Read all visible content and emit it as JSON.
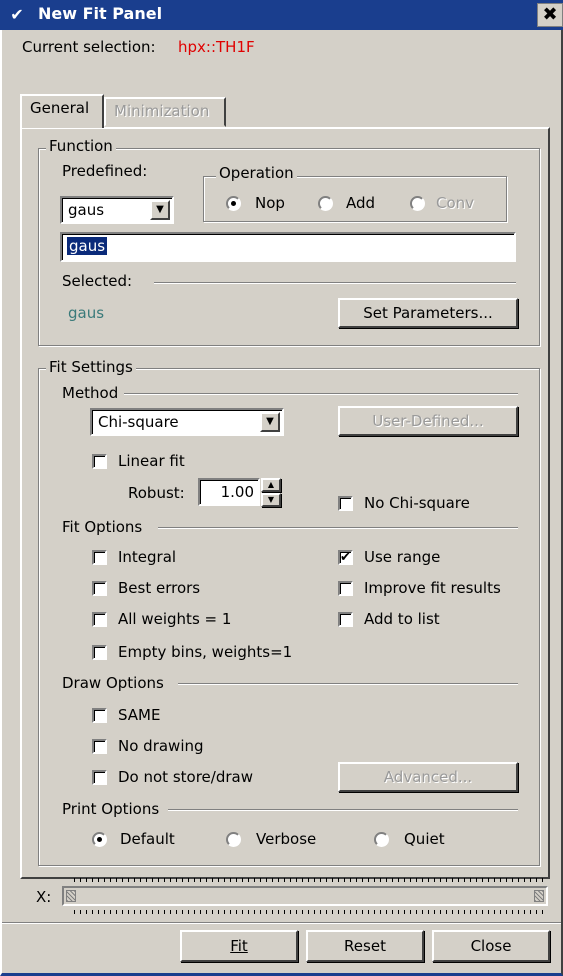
{
  "window": {
    "title": "New Fit Panel",
    "close_glyph": "✖",
    "menu_glyph": "✔"
  },
  "selection": {
    "label": "Current selection:",
    "value": "hpx::TH1F"
  },
  "tabs": [
    {
      "label": "General"
    },
    {
      "label": "Minimization"
    }
  ],
  "function": {
    "title": "Function",
    "predefined_label": "Predefined:",
    "predefined_value": "gaus",
    "operation": {
      "title": "Operation",
      "options": [
        {
          "label": "Nop",
          "selected": true
        },
        {
          "label": "Add",
          "selected": false
        },
        {
          "label": "Conv",
          "selected": false,
          "disabled": true
        }
      ]
    },
    "formula_value": "gaus",
    "selected_label": "Selected:",
    "selected_value": "gaus",
    "set_parameters_label": "Set Parameters..."
  },
  "fit_settings": {
    "title": "Fit Settings",
    "method": {
      "title": "Method",
      "value": "Chi-square",
      "user_defined_label": "User-Defined...",
      "linear_fit_label": "Linear fit",
      "robust_label": "Robust:",
      "robust_value": "1.00",
      "no_chi_square_label": "No Chi-square"
    },
    "fit_options": {
      "title": "Fit Options",
      "left": [
        {
          "label": "Integral",
          "checked": false
        },
        {
          "label": "Best errors",
          "checked": false
        },
        {
          "label": "All weights = 1",
          "checked": false
        },
        {
          "label": "Empty bins, weights=1",
          "checked": false
        }
      ],
      "right": [
        {
          "label": "Use range",
          "checked": true
        },
        {
          "label": "Improve fit results",
          "checked": false
        },
        {
          "label": "Add to list",
          "checked": false
        }
      ]
    },
    "draw_options": {
      "title": "Draw Options",
      "items": [
        {
          "label": "SAME",
          "checked": false
        },
        {
          "label": "No drawing",
          "checked": false
        },
        {
          "label": "Do not store/draw",
          "checked": false
        }
      ],
      "advanced_label": "Advanced..."
    },
    "print_options": {
      "title": "Print Options",
      "options": [
        {
          "label": "Default",
          "selected": true
        },
        {
          "label": "Verbose",
          "selected": false
        },
        {
          "label": "Quiet",
          "selected": false
        }
      ]
    }
  },
  "slider": {
    "label": "X:"
  },
  "footer": {
    "fit_label": "Fit",
    "reset_label": "Reset",
    "close_label": "Close"
  },
  "colors": {
    "title_bar": "#1a3e8e",
    "selection_value": "#e00000",
    "selected_function": "#3a7a7a",
    "highlight": "#0a2a7a"
  }
}
